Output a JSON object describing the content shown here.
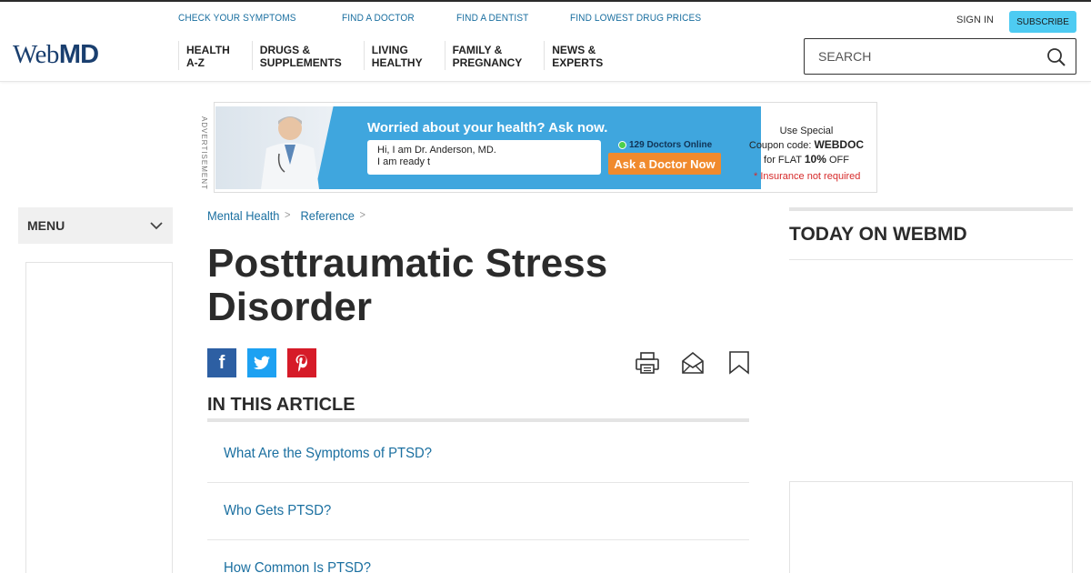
{
  "brand": {
    "logo_web": "Web",
    "logo_md": "MD"
  },
  "header": {
    "util_links": [
      "CHECK YOUR SYMPTOMS",
      "FIND A DOCTOR",
      "FIND A DENTIST",
      "FIND LOWEST DRUG PRICES"
    ],
    "sign_in": "SIGN IN",
    "subscribe": "SUBSCRIBE",
    "nav": [
      {
        "line1": "HEALTH",
        "line2": "A-Z"
      },
      {
        "line1": "DRUGS &",
        "line2": "SUPPLEMENTS"
      },
      {
        "line1": "LIVING",
        "line2": "HEALTHY"
      },
      {
        "line1": "FAMILY &",
        "line2": "PREGNANCY"
      },
      {
        "line1": "NEWS &",
        "line2": "EXPERTS"
      }
    ],
    "search_placeholder": "SEARCH"
  },
  "ad": {
    "label": "ADVERTISEMENT",
    "headline": "Worried about your health? Ask now.",
    "chat_line1": "Hi, I am Dr. Anderson, MD.",
    "chat_line2": "I am ready t",
    "online": "129 Doctors Online",
    "cta": "Ask a Doctor Now",
    "coupon_line1": "Use Special",
    "coupon_line2_prefix": "Coupon code: ",
    "coupon_code": "WEBDOC",
    "coupon_line3_prefix": "for FLAT ",
    "coupon_percent": "10%",
    "coupon_line3_suffix": " OFF",
    "insurance": "* Insurance not required"
  },
  "menu": {
    "label": "MENU"
  },
  "breadcrumb": [
    "Mental Health",
    "Reference"
  ],
  "article": {
    "title": "Posttraumatic Stress Disorder",
    "in_this_article": "IN THIS ARTICLE",
    "toc": [
      "What Are the Symptoms of PTSD?",
      "Who Gets PTSD?",
      "How Common Is PTSD?"
    ]
  },
  "sidebar": {
    "today_title": "TODAY ON WEBMD"
  },
  "colors": {
    "link": "#1a6fa0",
    "accent": "#4ecbf2",
    "facebook": "#2d5fa3",
    "twitter": "#1da1f2",
    "pinterest": "#d61b28",
    "cta": "#f08a2d"
  }
}
